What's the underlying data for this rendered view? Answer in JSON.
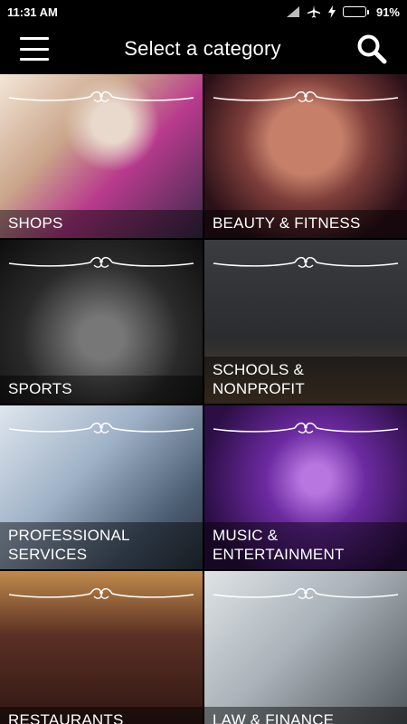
{
  "status_bar": {
    "time": "11:31 AM",
    "battery_percent": "91%",
    "battery_level": 0.91,
    "icons": [
      "signal-icon",
      "airplane-icon",
      "charging-icon",
      "battery-icon"
    ]
  },
  "app_bar": {
    "title": "Select a category",
    "menu_icon": "hamburger-menu-icon",
    "search_icon": "search-icon"
  },
  "categories": [
    {
      "id": "shops",
      "label_lines": [
        "SHOPS"
      ]
    },
    {
      "id": "beauty-fitness",
      "label_lines": [
        "BEAUTY & FITNESS"
      ]
    },
    {
      "id": "sports",
      "label_lines": [
        "SPORTS"
      ]
    },
    {
      "id": "schools-nonprofit",
      "label_lines": [
        "SCHOOLS & NONPROFIT"
      ]
    },
    {
      "id": "professional-services",
      "label_lines": [
        "PROFESSIONAL",
        "SERVICES"
      ]
    },
    {
      "id": "music-entertainment",
      "label_lines": [
        "MUSIC &",
        "ENTERTAINMENT"
      ]
    },
    {
      "id": "restaurants",
      "label_lines": [
        "RESTAURANTS"
      ]
    },
    {
      "id": "law-finance",
      "label_lines": [
        "LAW & FINANCE"
      ]
    }
  ],
  "colors": {
    "background": "#000000",
    "text": "#ffffff",
    "battery_fill": "#34c13a",
    "caption_overlay": "rgba(0,0,0,0.45)"
  }
}
